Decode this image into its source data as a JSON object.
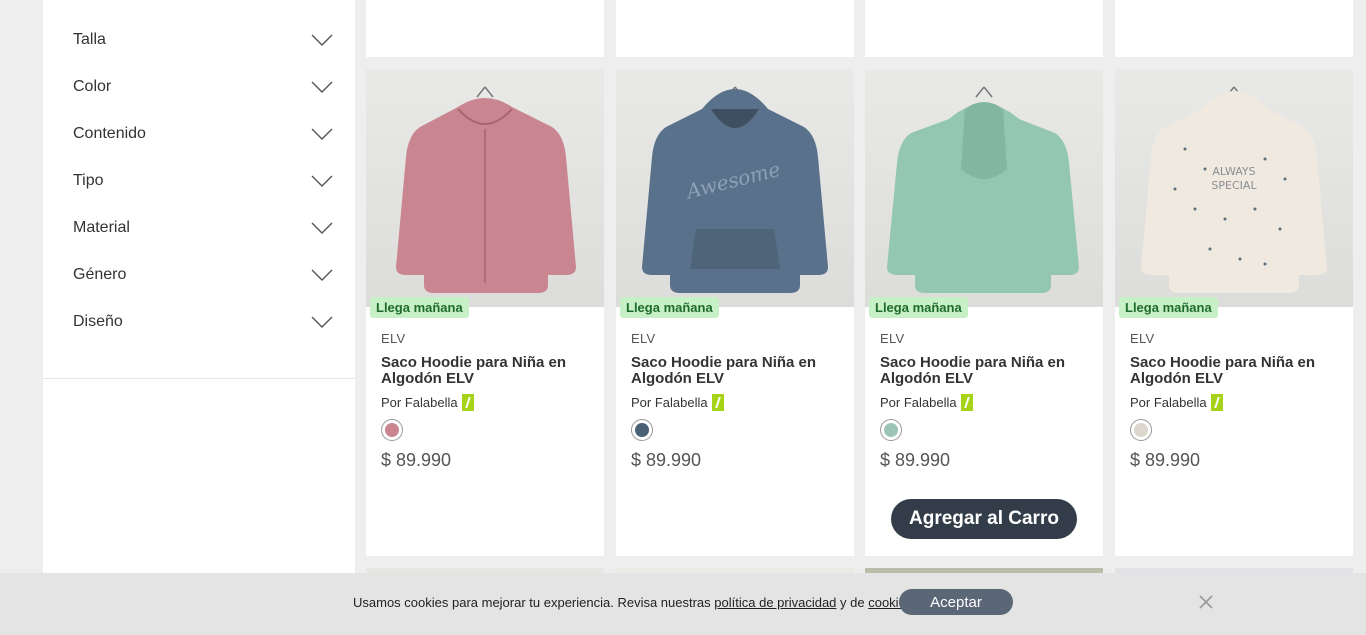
{
  "sidebar": {
    "filters": [
      {
        "label": "Talla"
      },
      {
        "label": "Color"
      },
      {
        "label": "Contenido"
      },
      {
        "label": "Tipo"
      },
      {
        "label": "Material"
      },
      {
        "label": "Género"
      },
      {
        "label": "Diseño"
      }
    ]
  },
  "products": [
    {
      "badge": "Llega mañana",
      "brand": "ELV",
      "title": "Saco Hoodie para Niña en Algodón ELV",
      "seller": "Por Falabella",
      "price": "$ 89.990",
      "swatch": "#c98590",
      "garment": "#c98590"
    },
    {
      "badge": "Llega mañana",
      "brand": "ELV",
      "title": "Saco Hoodie para Niña en Algodón ELV",
      "seller": "Por Falabella",
      "price": "$ 89.990",
      "swatch": "#4a6075",
      "garment": "#59718a"
    },
    {
      "badge": "Llega mañana",
      "brand": "ELV",
      "title": "Saco Hoodie para Niña en Algodón ELV",
      "seller": "Por Falabella",
      "price": "$ 89.990",
      "swatch": "#9cc4b6",
      "garment": "#94c6b4"
    },
    {
      "badge": "Llega mañana",
      "brand": "ELV",
      "title": "Saco Hoodie para Niña en Algodón ELV",
      "seller": "Por Falabella",
      "price": "$ 89.990",
      "swatch": "#ddd6cc",
      "garment": "#efe9df"
    }
  ],
  "cart_button_label": "Agregar al Carro",
  "cookie": {
    "text_before": "Usamos cookies para mejorar tu experiencia. Revisa nuestras ",
    "privacy_link": "política de privacidad",
    "text_middle": " y de ",
    "cookies_link": "cookies",
    "text_end": ".",
    "accept_label": "Aceptar"
  },
  "colors": {
    "badge_bg": "#c7f0c6",
    "badge_text": "#1f6b2a",
    "cart_button": "#333d4a",
    "accept_button": "#5b6676",
    "seller_mark": "#a6d218"
  }
}
